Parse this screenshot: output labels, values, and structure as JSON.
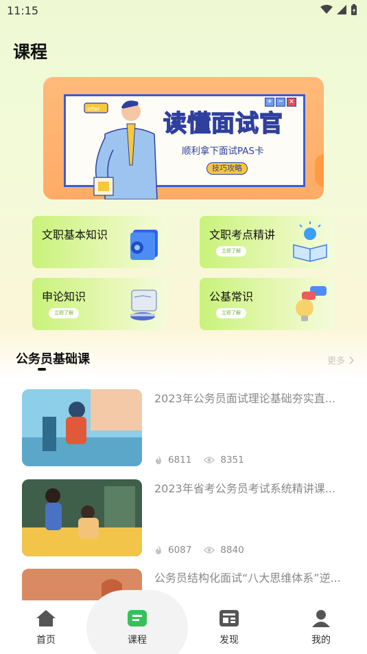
{
  "status": {
    "time": "11:15"
  },
  "page": {
    "title": "课程"
  },
  "banner": {
    "title": "读懂面试官",
    "subtitle": "顺利拿下面试PAS卡",
    "pill": "技巧攻略",
    "tag": "offer"
  },
  "categories": [
    {
      "title": "文职基本知识",
      "pill": ""
    },
    {
      "title": "文职考点精讲",
      "pill": "立即了解"
    },
    {
      "title": "申论知识",
      "pill": "立即了解"
    },
    {
      "title": "公基常识",
      "pill": "立即了解"
    }
  ],
  "section": {
    "title": "公务员基础课",
    "more": "更多"
  },
  "courses": [
    {
      "title": "2023年公务员面试理论基础夯实直...",
      "hot": "6811",
      "views": "8351"
    },
    {
      "title": "2023年省考公务员考试系统精讲课...",
      "hot": "6087",
      "views": "8840"
    },
    {
      "title": "公务员结构化面试“八大思维体系”逆...",
      "hot": "",
      "views": ""
    }
  ],
  "nav": [
    {
      "label": "首页",
      "icon": "home-icon"
    },
    {
      "label": "课程",
      "icon": "course-icon",
      "active": true
    },
    {
      "label": "发现",
      "icon": "discover-icon"
    },
    {
      "label": "我的",
      "icon": "profile-icon"
    }
  ],
  "colors": {
    "accent": "#37c05a",
    "banner": "#ffab66",
    "card": "#c9f27a"
  }
}
